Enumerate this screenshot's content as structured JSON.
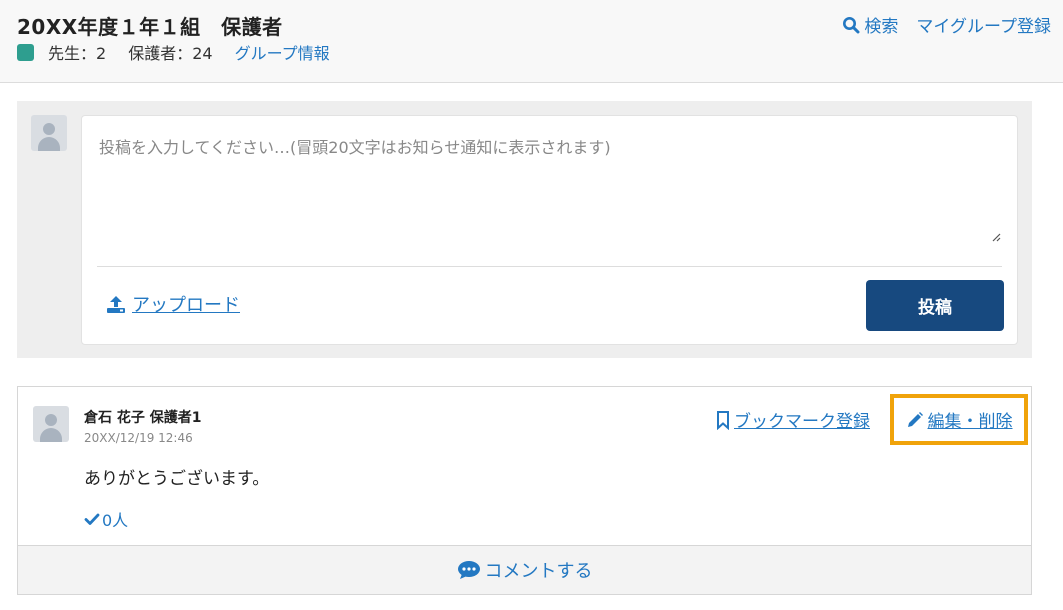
{
  "header": {
    "title": "20XX年度１年１組　保護者",
    "teachers": "先生：2",
    "guardians": "保護者：24",
    "group_info": "グループ情報",
    "search": "検索",
    "mygroup": "マイグループ登録"
  },
  "composer": {
    "placeholder": "投稿を入力してください…(冒頭20文字はお知らせ通知に表示されます)",
    "upload_label": "アップロード",
    "post_button": "投稿"
  },
  "post": {
    "author": "倉石 花子 保護者1",
    "timestamp": "20XX/12/19 12:46",
    "body": "ありがとうございます。",
    "likes": "0人",
    "bookmark": "ブックマーク登録",
    "edit": "編集・削除",
    "comment": "コメントする"
  },
  "colors": {
    "accent": "#2378c2",
    "primary_button": "#17497f",
    "highlight": "#f0a30a",
    "group_badge": "#2e9e8f"
  },
  "icons": [
    "search-icon",
    "upload-icon",
    "bookmark-icon",
    "pencil-icon",
    "check-icon",
    "comment-icon",
    "avatar"
  ]
}
